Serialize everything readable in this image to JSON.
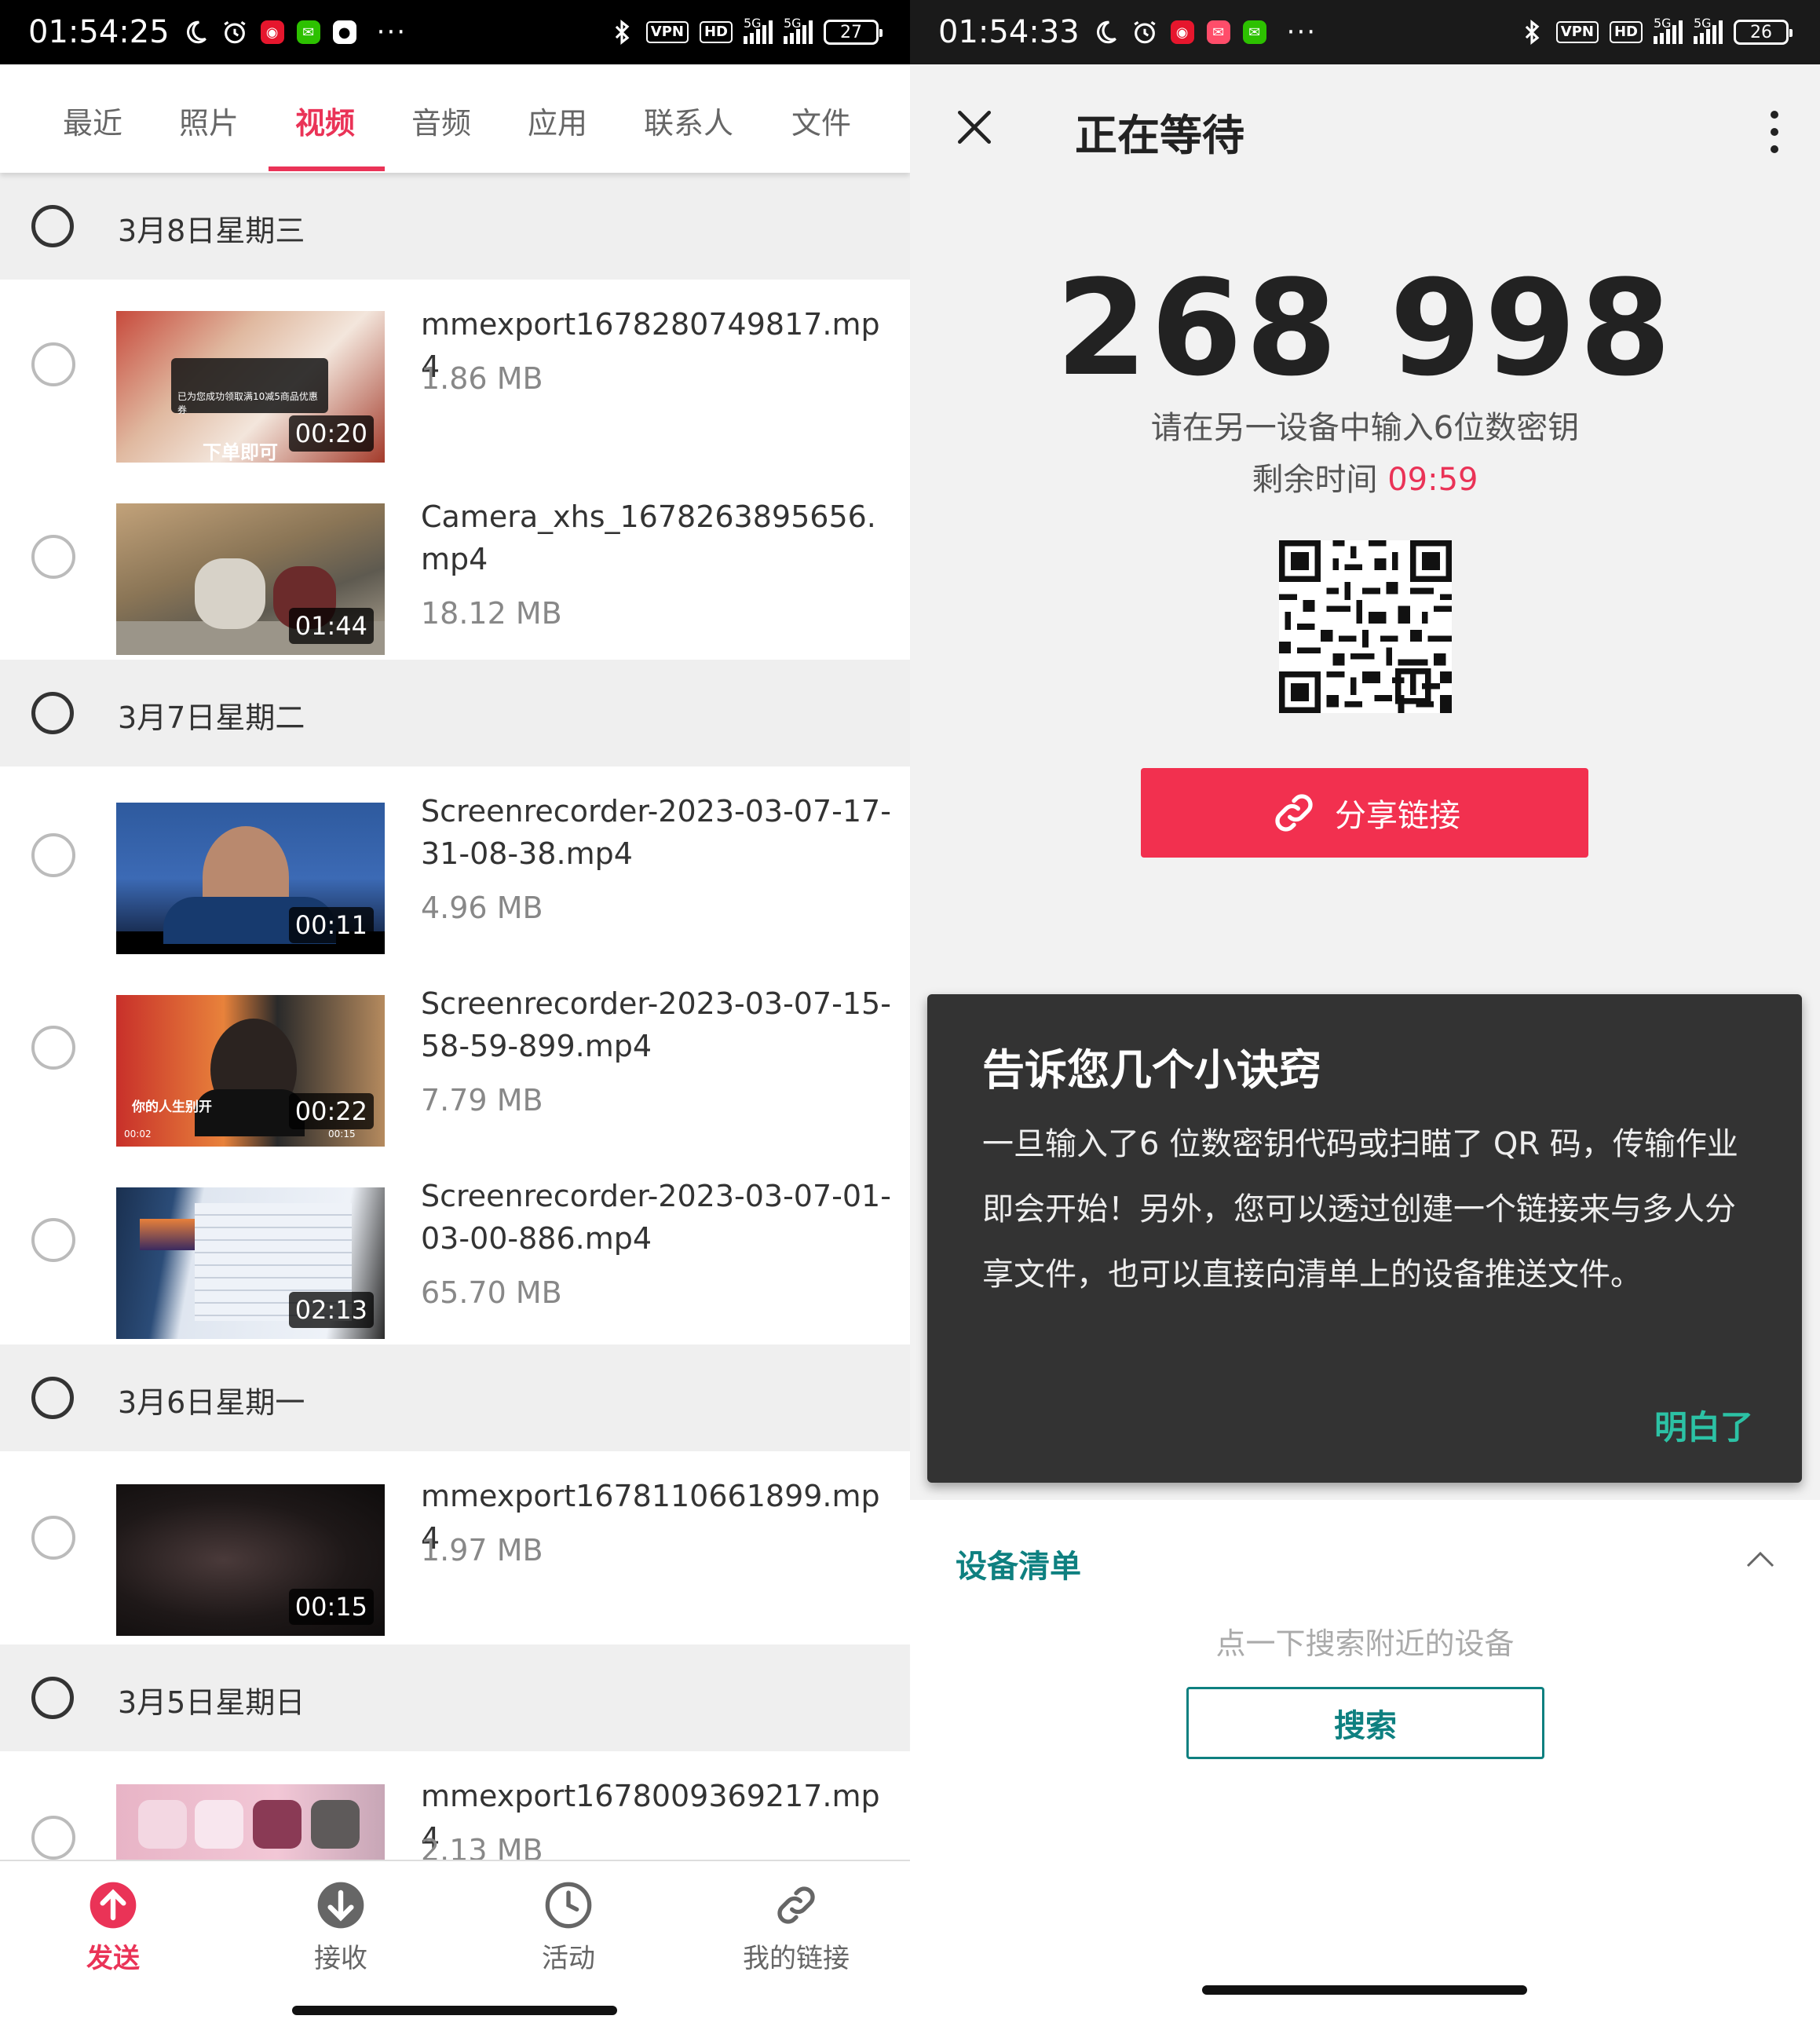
{
  "left": {
    "status_bar": {
      "time": "01:54:25",
      "vpn": "VPN",
      "hd": "HD",
      "net1": "5G",
      "net2": "5G",
      "battery": "27"
    },
    "tabs": [
      {
        "label": "最近"
      },
      {
        "label": "照片"
      },
      {
        "label": "视频"
      },
      {
        "label": "音频"
      },
      {
        "label": "应用"
      },
      {
        "label": "联系人"
      },
      {
        "label": "文件"
      }
    ],
    "active_tab": "视频",
    "groups": [
      {
        "date": "3月8日星期三",
        "items": [
          {
            "name": "mmexport1678280749817.mp4",
            "size": "1.86 MB",
            "duration": "00:20"
          },
          {
            "name": "Camera_xhs_1678263895656.mp4",
            "size": "18.12 MB",
            "duration": "01:44"
          }
        ]
      },
      {
        "date": "3月7日星期二",
        "items": [
          {
            "name": "Screenrecorder-2023-03-07-17-31-08-38.mp4",
            "size": "4.96 MB",
            "duration": "00:11"
          },
          {
            "name": "Screenrecorder-2023-03-07-15-58-59-899.mp4",
            "size": "7.79 MB",
            "duration": "00:22"
          },
          {
            "name": "Screenrecorder-2023-03-07-01-03-00-886.mp4",
            "size": "65.70 MB",
            "duration": "02:13"
          }
        ]
      },
      {
        "date": "3月6日星期一",
        "items": [
          {
            "name": "mmexport1678110661899.mp4",
            "size": "1.97 MB",
            "duration": "00:15"
          }
        ]
      },
      {
        "date": "3月5日星期日",
        "items": [
          {
            "name": "mmexport1678009369217.mp4",
            "size": "2.13 MB",
            "duration": ""
          }
        ]
      }
    ],
    "thumb_text": {
      "t1_banner": "下单即可",
      "t1_toast": "已为您成功领取满10减5商品优惠券",
      "t4_caption": "你的人生别开",
      "t4_left": "00:02",
      "t4_right": "00:15"
    },
    "bottom_nav": [
      {
        "label": "发送",
        "icon": "upload-arrow-icon"
      },
      {
        "label": "接收",
        "icon": "download-arrow-icon"
      },
      {
        "label": "活动",
        "icon": "clock-icon"
      },
      {
        "label": "我的链接",
        "icon": "link-icon"
      }
    ]
  },
  "right": {
    "status_bar": {
      "time": "01:54:33",
      "vpn": "VPN",
      "hd": "HD",
      "net1": "5G",
      "net2": "5G",
      "battery": "26"
    },
    "title": "正在等待",
    "pin": "268 998",
    "pin_hint": "请在另一设备中输入6位数密钥",
    "timer_label": "剩余时间",
    "timer_value": "09:59",
    "share_button": "分享链接",
    "tip": {
      "title": "告诉您几个小诀窍",
      "body": "一旦输入了6 位数密钥代码或扫瞄了 QR 码，传输作业即会开始！另外，您可以透过创建一个链接来与多人分享文件，也可以直接向清单上的设备推送文件。",
      "ok": "明白了"
    },
    "devices": {
      "title": "设备清单",
      "hint": "点一下搜索附近的设备",
      "search_button": "搜索"
    }
  },
  "colors": {
    "accent": "#ea3357",
    "teal": "#0e8080",
    "tip_bg": "#333333",
    "tip_ok": "#2cc2a5"
  }
}
